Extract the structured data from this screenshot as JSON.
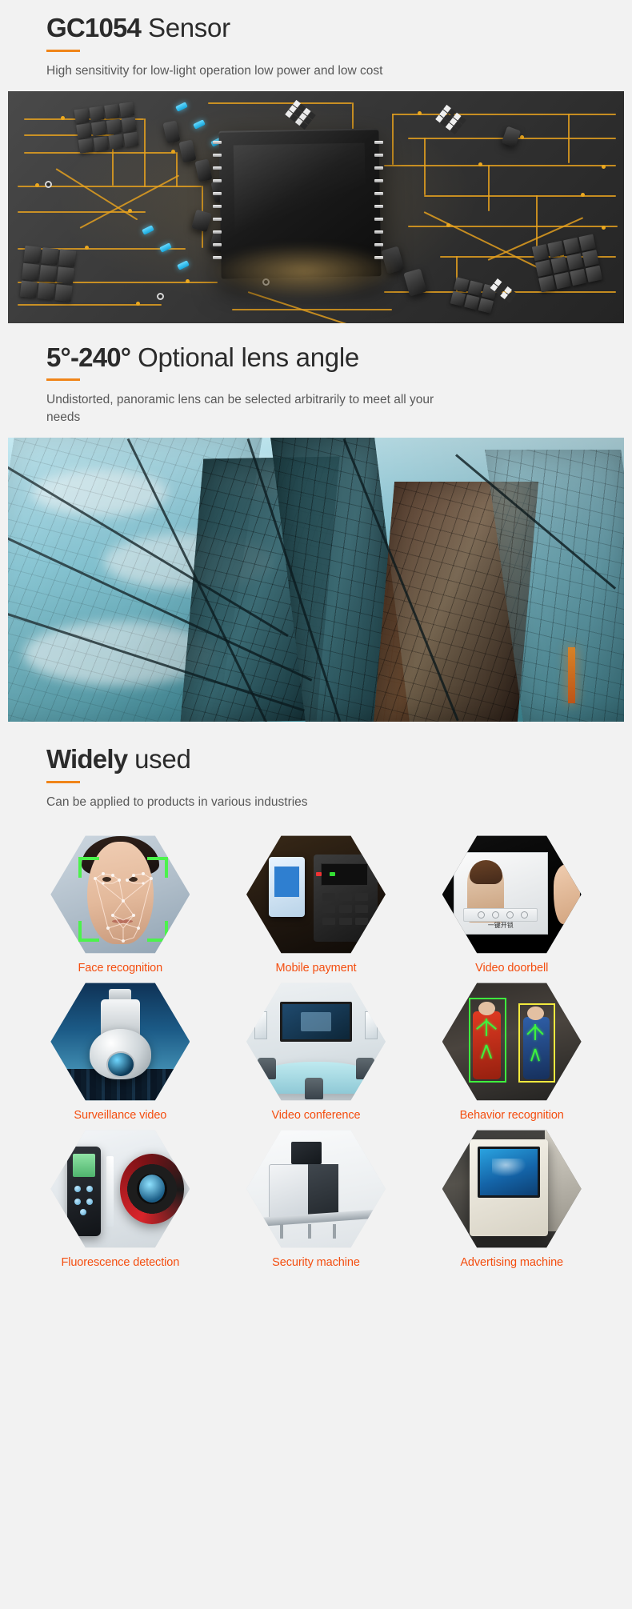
{
  "theme": {
    "background": "#f2f2f2",
    "accent_bar": "#f08519",
    "heading_color": "#2b2b2b",
    "subtitle_color": "#585858",
    "label_color": "#f44e10"
  },
  "sections": [
    {
      "id": "sensor",
      "heading_strong": "GC1054",
      "heading_light": " Sensor",
      "subtitle": "High sensitivity for low-light operation low power and low cost",
      "image_name": "pcb-circuit-board-photo"
    },
    {
      "id": "lens-angle",
      "heading_strong": "5°-240°",
      "heading_light": " Optional lens angle",
      "subtitle": "Undistorted, panoramic lens can be selected arbitrarily to meet all your needs",
      "image_name": "glass-skyscraper-photo"
    },
    {
      "id": "widely-used",
      "heading_strong": "Widely",
      "heading_light": " used",
      "subtitle": "Can be applied to products in various industries"
    }
  ],
  "applications": [
    {
      "label": "Face recognition",
      "image_name": "face-recognition-thumbnail"
    },
    {
      "label": "Mobile payment",
      "image_name": "mobile-payment-thumbnail"
    },
    {
      "label": "Video doorbell",
      "image_name": "video-doorbell-thumbnail",
      "overlay_text": "一键开锁"
    },
    {
      "label": "Surveillance video",
      "image_name": "surveillance-camera-thumbnail"
    },
    {
      "label": "Video conference",
      "image_name": "video-conference-thumbnail"
    },
    {
      "label": "Behavior recognition",
      "image_name": "behavior-recognition-thumbnail"
    },
    {
      "label": "Fluorescence detection",
      "image_name": "fluorescence-detector-thumbnail"
    },
    {
      "label": "Security machine",
      "image_name": "xray-security-scanner-thumbnail"
    },
    {
      "label": "Advertising machine",
      "image_name": "advertising-kiosk-thumbnail"
    }
  ]
}
